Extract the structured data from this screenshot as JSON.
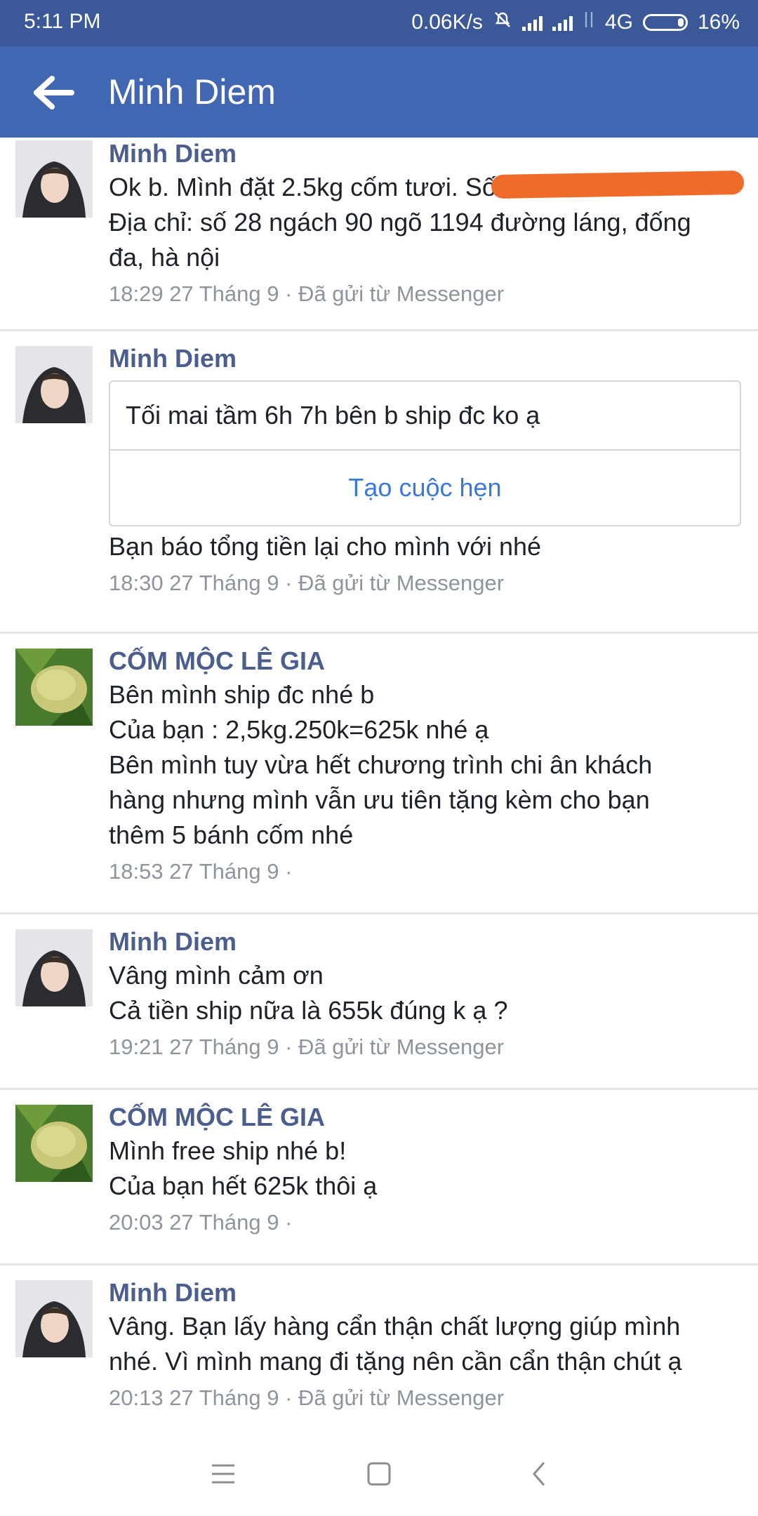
{
  "status_bar": {
    "time": "5:11 PM",
    "speed": "0.06K/s",
    "network": "4G",
    "battery": "16%"
  },
  "header": {
    "title": "Minh Diem"
  },
  "messages": [
    {
      "sender": "Minh Diem",
      "avatar": "person-avatar",
      "lines": [
        "Ok b. Mình đặt 2.5kg cốm tươi. Số đt 0914",
        "Địa chỉ: số 28 ngách 90 ngõ 1194 đường láng, đống",
        "đa, hà nội"
      ],
      "meta": "18:29 27 Tháng 9 · Đã gửi từ Messenger"
    },
    {
      "sender": "Minh Diem",
      "avatar": "person-avatar",
      "card": {
        "text": "Tối mai tầm 6h 7h bên b ship đc ko ạ",
        "action": "Tạo cuộc hẹn"
      },
      "lines": [
        "Bạn báo tổng tiền lại cho mình với nhé"
      ],
      "meta": "18:30 27 Tháng 9 · Đã gửi từ Messenger"
    },
    {
      "sender": "CỐM MỘC LÊ GIA",
      "avatar": "com-avatar",
      "lines": [
        "Bên mình ship đc nhé b",
        "Của bạn : 2,5kg.250k=625k nhé ạ",
        "Bên mình tuy vừa hết chương trình chi ân khách",
        "hàng nhưng mình vẫn ưu tiên tặng kèm cho bạn",
        "thêm 5 bánh cốm nhé"
      ],
      "meta": "18:53 27 Tháng 9 ·"
    },
    {
      "sender": "Minh Diem",
      "avatar": "person-avatar",
      "lines": [
        "Vâng mình cảm ơn",
        "Cả tiền ship nữa là 655k đúng k ạ ?"
      ],
      "meta": "19:21 27 Tháng 9 · Đã gửi từ Messenger"
    },
    {
      "sender": "CỐM MỘC LÊ GIA",
      "avatar": "com-avatar",
      "lines": [
        "Mình free ship nhé b!",
        "Của bạn hết 625k thôi ạ"
      ],
      "meta": "20:03 27 Tháng 9 ·"
    },
    {
      "sender": "Minh Diem",
      "avatar": "person-avatar",
      "lines": [
        "Vâng. Bạn lấy hàng cẩn thận chất lượng giúp mình",
        "nhé. Vì mình mang đi tặng nên cần cẩn thận chút ạ"
      ],
      "meta": "20:13 27 Tháng 9 · Đã gửi từ Messenger"
    }
  ],
  "nav_bar": {
    "icons": [
      "menu-icon",
      "home-square-icon",
      "back-chevron-icon"
    ]
  },
  "colors": {
    "status_bar": "#3b5998",
    "app_bar": "#4267b2",
    "sender": "#4b5e8e",
    "meta": "#8d949e",
    "link": "#3b79d6",
    "redaction": "#f06a2a"
  }
}
